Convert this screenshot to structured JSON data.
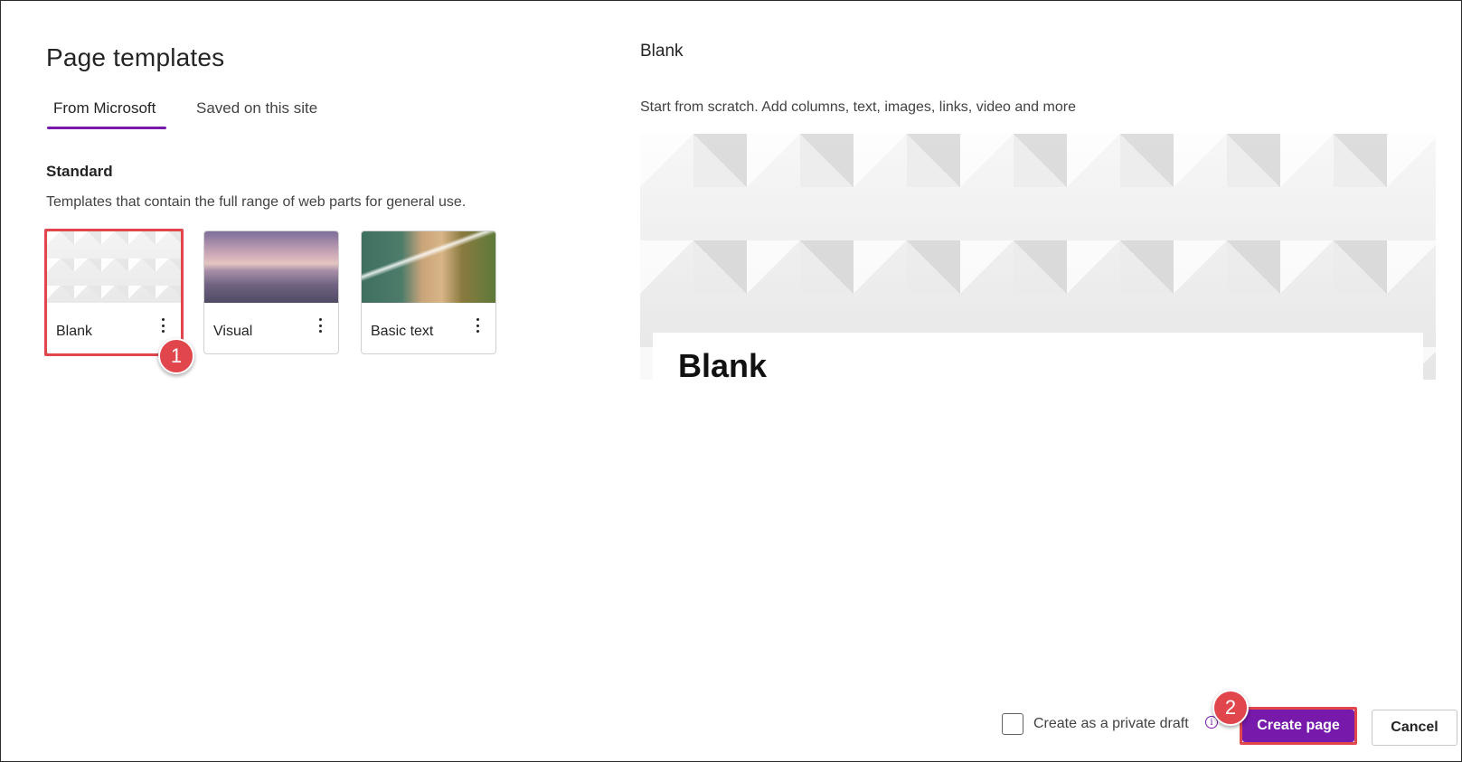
{
  "panel": {
    "title": "Page templates",
    "tabs": [
      {
        "label": "From Microsoft",
        "active": true
      },
      {
        "label": "Saved on this site",
        "active": false
      }
    ],
    "section": {
      "heading": "Standard",
      "description": "Templates that contain the full range of web parts for general use."
    },
    "templates": [
      {
        "label": "Blank",
        "selected": true,
        "more_icon": "more-vertical-icon"
      },
      {
        "label": "Visual",
        "selected": false,
        "more_icon": "more-vertical-icon"
      },
      {
        "label": "Basic text",
        "selected": false,
        "more_icon": "more-vertical-icon"
      }
    ]
  },
  "preview": {
    "title": "Blank",
    "description": "Start from scratch. Add columns, text, images, links, video and more",
    "heading": "Blank"
  },
  "footer": {
    "private_draft_label": "Create as a private draft",
    "private_draft_checked": false,
    "info_icon": "i",
    "create_label": "Create page",
    "cancel_label": "Cancel"
  },
  "annotations": {
    "step1": "1",
    "step2": "2"
  },
  "colors": {
    "accent": "#7719aa",
    "annotation": "#e0464c"
  }
}
